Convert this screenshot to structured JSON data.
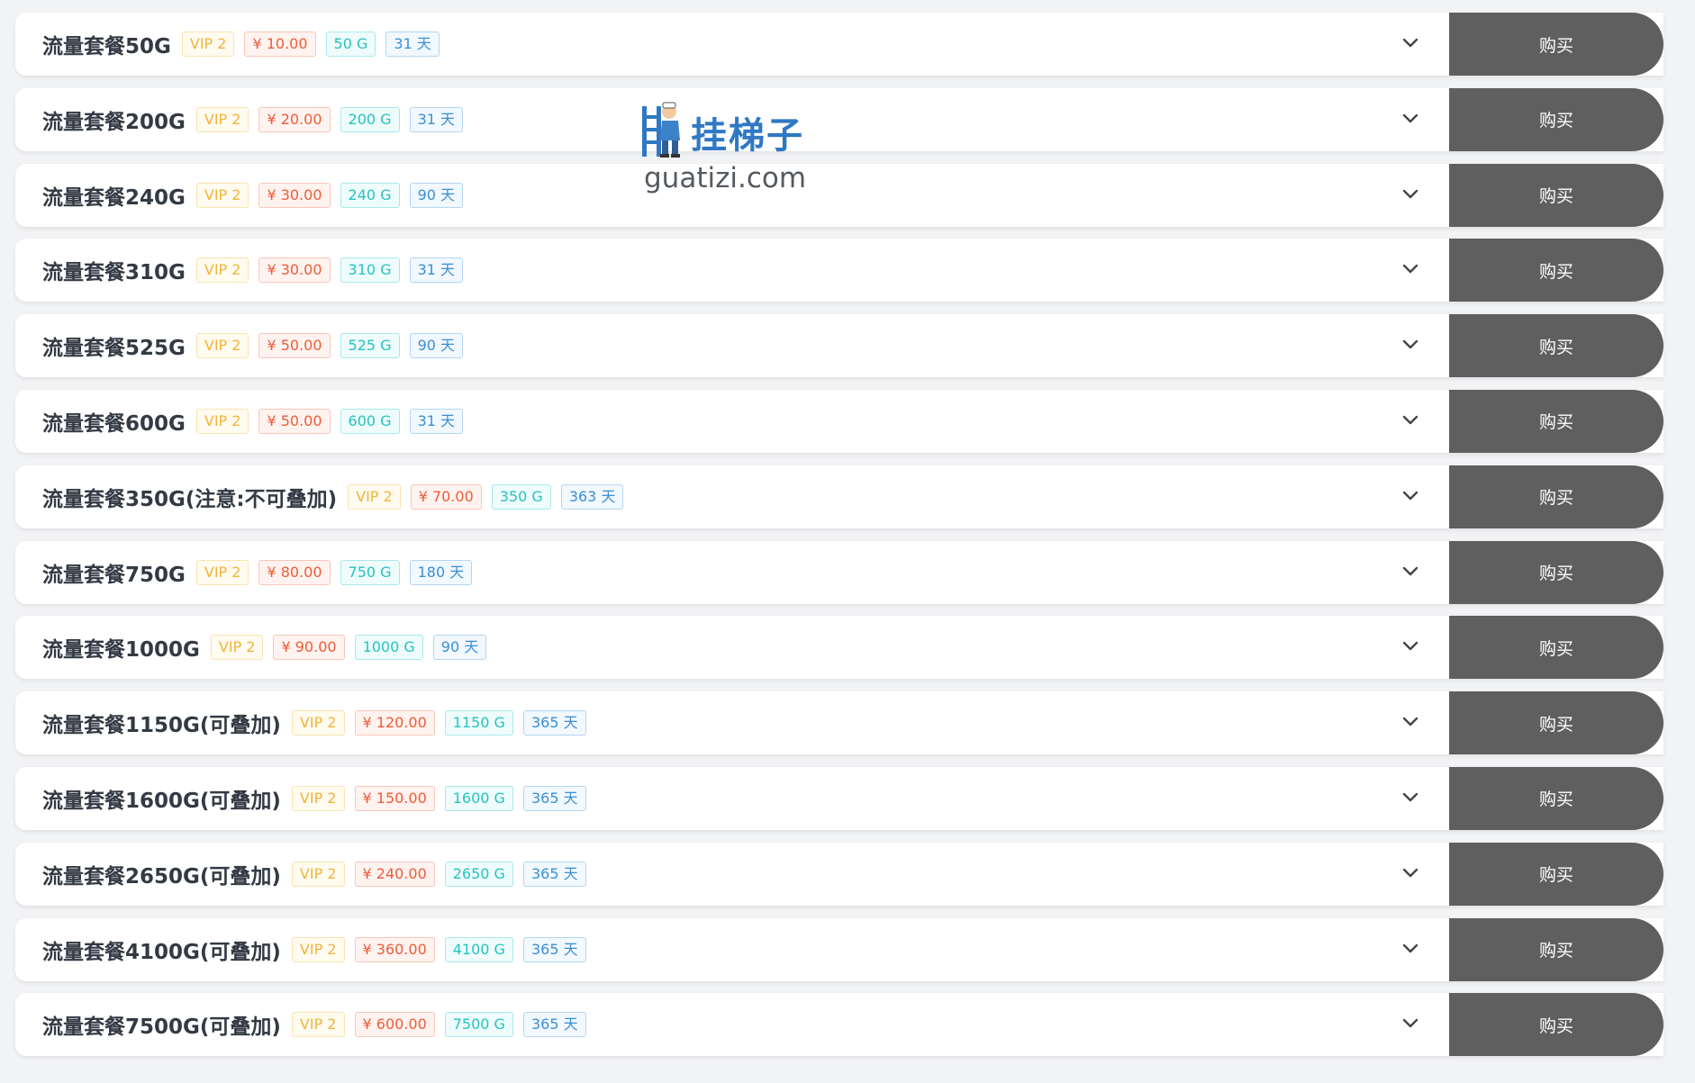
{
  "buy_label": "购买",
  "watermark": {
    "title": "挂梯子",
    "url": "guatizi.com"
  },
  "plans": [
    {
      "name": "流量套餐50G",
      "vip": "VIP 2",
      "price": "¥ 10.00",
      "traffic": "50 G",
      "days": "31 天"
    },
    {
      "name": "流量套餐200G",
      "vip": "VIP 2",
      "price": "¥ 20.00",
      "traffic": "200 G",
      "days": "31 天"
    },
    {
      "name": "流量套餐240G",
      "vip": "VIP 2",
      "price": "¥ 30.00",
      "traffic": "240 G",
      "days": "90 天"
    },
    {
      "name": "流量套餐310G",
      "vip": "VIP 2",
      "price": "¥ 30.00",
      "traffic": "310 G",
      "days": "31 天"
    },
    {
      "name": "流量套餐525G",
      "vip": "VIP 2",
      "price": "¥ 50.00",
      "traffic": "525 G",
      "days": "90 天"
    },
    {
      "name": "流量套餐600G",
      "vip": "VIP 2",
      "price": "¥ 50.00",
      "traffic": "600 G",
      "days": "31 天"
    },
    {
      "name": "流量套餐350G(注意:不可叠加)",
      "vip": "VIP 2",
      "price": "¥ 70.00",
      "traffic": "350 G",
      "days": "363 天"
    },
    {
      "name": "流量套餐750G",
      "vip": "VIP 2",
      "price": "¥ 80.00",
      "traffic": "750 G",
      "days": "180 天"
    },
    {
      "name": "流量套餐1000G",
      "vip": "VIP 2",
      "price": "¥ 90.00",
      "traffic": "1000 G",
      "days": "90 天"
    },
    {
      "name": "流量套餐1150G(可叠加)",
      "vip": "VIP 2",
      "price": "¥ 120.00",
      "traffic": "1150 G",
      "days": "365 天"
    },
    {
      "name": "流量套餐1600G(可叠加)",
      "vip": "VIP 2",
      "price": "¥ 150.00",
      "traffic": "1600 G",
      "days": "365 天"
    },
    {
      "name": "流量套餐2650G(可叠加)",
      "vip": "VIP 2",
      "price": "¥ 240.00",
      "traffic": "2650 G",
      "days": "365 天"
    },
    {
      "name": "流量套餐4100G(可叠加)",
      "vip": "VIP 2",
      "price": "¥ 360.00",
      "traffic": "4100 G",
      "days": "365 天"
    },
    {
      "name": "流量套餐7500G(可叠加)",
      "vip": "VIP 2",
      "price": "¥ 600.00",
      "traffic": "7500 G",
      "days": "365 天"
    }
  ],
  "colors": {
    "vip": "#f0b43c",
    "price": "#ef5b3a",
    "traffic": "#26c2c2",
    "days": "#3a8fd6",
    "buy_button": "#5f5f5f",
    "watermark": "#2f78c4"
  },
  "icons": {
    "expand": "chevron-down-icon",
    "logo": "ladder-worker-icon"
  }
}
